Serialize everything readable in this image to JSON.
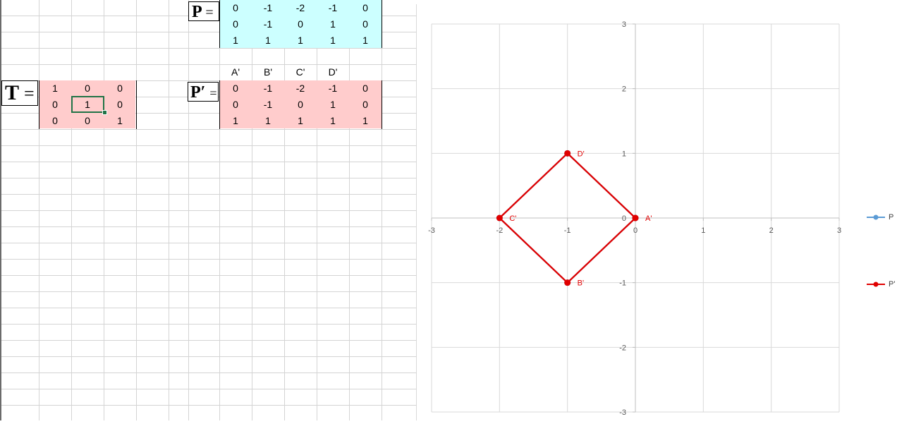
{
  "matrix_P": {
    "label": "P",
    "equals": "=",
    "rows": [
      [
        "0",
        "-1",
        "-2",
        "-1",
        "0"
      ],
      [
        "0",
        "-1",
        "0",
        "1",
        "0"
      ],
      [
        "1",
        "1",
        "1",
        "1",
        "1"
      ]
    ],
    "fill_color": "#ccffff"
  },
  "matrix_T": {
    "label": "T",
    "equals": "=",
    "rows": [
      [
        "1",
        "0",
        "0"
      ],
      [
        "0",
        "1",
        "0"
      ],
      [
        "0",
        "0",
        "1"
      ]
    ],
    "selected_cell": "1",
    "fill_color": "#ffcccc"
  },
  "matrix_Pprime": {
    "label": "P′",
    "equals": "=",
    "headers": [
      "A'",
      "B'",
      "C'",
      "D'"
    ],
    "rows": [
      [
        "0",
        "-1",
        "-2",
        "-1",
        "0"
      ],
      [
        "0",
        "-1",
        "0",
        "1",
        "0"
      ],
      [
        "1",
        "1",
        "1",
        "1",
        "1"
      ]
    ],
    "fill_color": "#ffcccc"
  },
  "chart_data": {
    "type": "scatter",
    "title": "",
    "xlabel": "",
    "ylabel": "",
    "xlim": [
      -3,
      3
    ],
    "ylim": [
      -3,
      3
    ],
    "x_ticks": [
      "-3",
      "-2",
      "-1",
      "0",
      "1",
      "2",
      "3"
    ],
    "y_ticks": [
      "-3",
      "-2",
      "-1",
      "0",
      "1",
      "2",
      "3"
    ],
    "grid": true,
    "legend_position": "right",
    "series": [
      {
        "name": "P",
        "color": "#5b9bd5",
        "x": [
          0,
          -1,
          -2,
          -1,
          0
        ],
        "y": [
          0,
          -1,
          0,
          1,
          0
        ],
        "point_labels": []
      },
      {
        "name": "P'",
        "color": "#e00000",
        "x": [
          0,
          -1,
          -2,
          -1,
          0
        ],
        "y": [
          0,
          -1,
          0,
          1,
          0
        ],
        "point_labels": [
          "A'",
          "B'",
          "C'",
          "D'"
        ]
      }
    ]
  }
}
